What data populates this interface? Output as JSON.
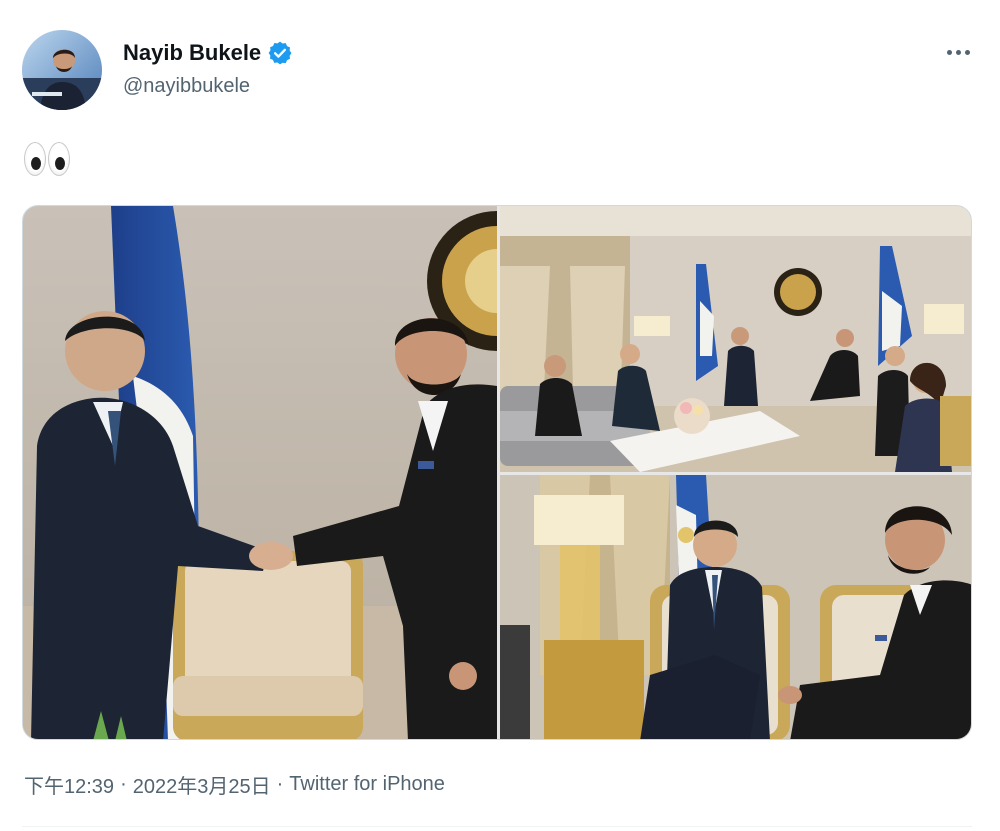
{
  "author": {
    "display_name": "Nayib Bukele",
    "handle": "@nayibbukele",
    "verified": true,
    "avatar_icon": "profile-photo"
  },
  "tweet": {
    "text_emoji": "eyes-emoji"
  },
  "media": [
    {
      "description_icon": "photo-handshake"
    },
    {
      "description_icon": "photo-meeting-room"
    },
    {
      "description_icon": "photo-seated-conversation"
    }
  ],
  "meta": {
    "time": "下午12:39",
    "date": "2022年3月25日",
    "separator": "·",
    "source": "Twitter for iPhone"
  },
  "colors": {
    "text_primary": "#0f1419",
    "text_secondary": "#536471",
    "verified_blue": "#1d9bf0",
    "border": "#cfd9de"
  }
}
